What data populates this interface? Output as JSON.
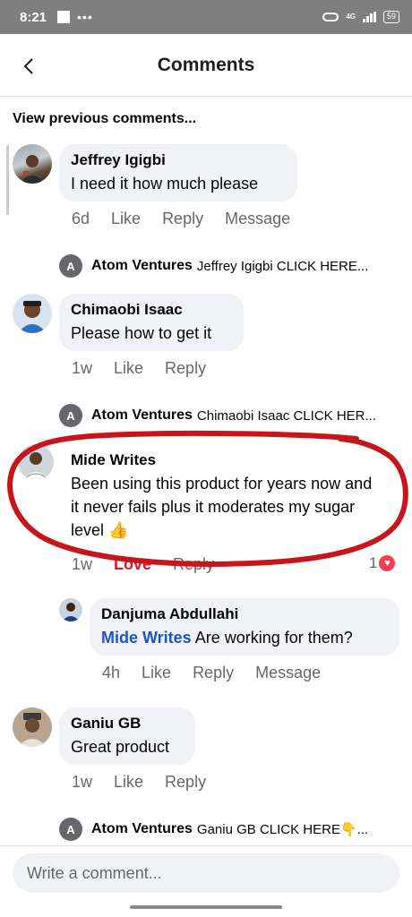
{
  "status_bar": {
    "time": "8:21",
    "network": "4G",
    "battery": "59"
  },
  "header": {
    "title": "Comments",
    "back_icon": "chevron-left-icon"
  },
  "view_previous": "View previous comments...",
  "comments": [
    {
      "author": "Jeffrey Igigbi",
      "text": "I need it how much please",
      "time": "6d",
      "actions": [
        "Like",
        "Reply",
        "Message"
      ]
    },
    {
      "reply_preview": {
        "avatar_letter": "A",
        "author": "Atom Ventures",
        "text": "Jeffrey Igigbi CLICK HERE..."
      }
    },
    {
      "author": "Chimaobi Isaac",
      "text": "Please how to get it",
      "time": "1w",
      "actions": [
        "Like",
        "Reply"
      ]
    },
    {
      "reply_preview": {
        "avatar_letter": "A",
        "author": "Atom Ventures",
        "text": "Chimaobi Isaac CLICK HER..."
      }
    },
    {
      "author": "Mide Writes",
      "text": "Been using this product for years now and it never fails plus it moderates my sugar level",
      "emoji": "👍",
      "time": "1w",
      "actions": [
        "Love",
        "Reply"
      ],
      "reaction_count": "1",
      "highlight_color": "#c8151d"
    },
    {
      "author": "Danjuma Abdullahi",
      "mention": "Mide Writes",
      "text": "Are working for them?",
      "time": "4h",
      "actions": [
        "Like",
        "Reply",
        "Message"
      ]
    },
    {
      "author": "Ganiu GB",
      "text": "Great product",
      "time": "1w",
      "actions": [
        "Like",
        "Reply"
      ]
    },
    {
      "reply_preview": {
        "avatar_letter": "A",
        "author": "Atom Ventures",
        "text": "Ganiu GB CLICK HERE👇...",
        "emoji": "👇"
      }
    }
  ],
  "composer": {
    "placeholder": "Write a comment..."
  },
  "colors": {
    "bubble": "#f0f2f5",
    "meta_text": "#65676b",
    "mention": "#1a56c6",
    "love": "#d11a2a",
    "scribble": "#c8151d"
  }
}
